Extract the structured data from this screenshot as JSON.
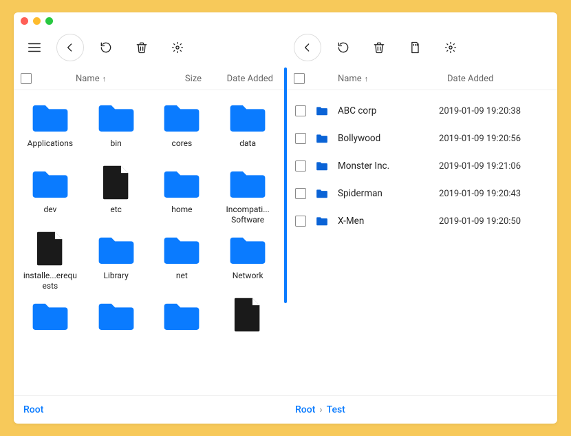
{
  "traffic_lights": {
    "close": "#ff5f57",
    "min": "#febc2e",
    "max": "#28c840"
  },
  "left": {
    "columns": {
      "name": "Name",
      "size": "Size",
      "date": "Date Added"
    },
    "sort_dir": "↑",
    "items": [
      {
        "name": "Applications",
        "kind": "folder",
        "color": "#0a7bff"
      },
      {
        "name": "bin",
        "kind": "folder",
        "color": "#0a7bff"
      },
      {
        "name": "cores",
        "kind": "folder",
        "color": "#0a7bff"
      },
      {
        "name": "data",
        "kind": "folder",
        "color": "#0a7bff"
      },
      {
        "name": "dev",
        "kind": "folder",
        "color": "#0a7bff"
      },
      {
        "name": "etc",
        "kind": "file",
        "color": "#1a1a1a"
      },
      {
        "name": "home",
        "kind": "folder",
        "color": "#0a7bff"
      },
      {
        "name": "Incompati... Software",
        "kind": "folder",
        "color": "#0a7bff"
      },
      {
        "name": "installe...erequests",
        "kind": "file",
        "color": "#1a1a1a"
      },
      {
        "name": "Library",
        "kind": "folder",
        "color": "#0a7bff"
      },
      {
        "name": "net",
        "kind": "folder",
        "color": "#0a7bff"
      },
      {
        "name": "Network",
        "kind": "folder",
        "color": "#0a7bff"
      },
      {
        "name": "",
        "kind": "folder",
        "color": "#0a7bff"
      },
      {
        "name": "",
        "kind": "folder",
        "color": "#0a7bff"
      },
      {
        "name": "",
        "kind": "folder",
        "color": "#0a7bff"
      },
      {
        "name": "",
        "kind": "file",
        "color": "#1a1a1a"
      }
    ],
    "breadcrumb": [
      "Root"
    ]
  },
  "right": {
    "columns": {
      "name": "Name",
      "date": "Date Added"
    },
    "sort_dir": "↑",
    "items": [
      {
        "name": "ABC corp",
        "date": "2019-01-09 19:20:38"
      },
      {
        "name": "Bollywood",
        "date": "2019-01-09 19:20:56"
      },
      {
        "name": "Monster Inc.",
        "date": "2019-01-09 19:21:06"
      },
      {
        "name": "Spiderman",
        "date": "2019-01-09 19:20:43"
      },
      {
        "name": "X-Men",
        "date": "2019-01-09 19:20:50"
      }
    ],
    "folder_color": "#0a63d6",
    "breadcrumb": [
      "Root",
      "Test"
    ]
  }
}
